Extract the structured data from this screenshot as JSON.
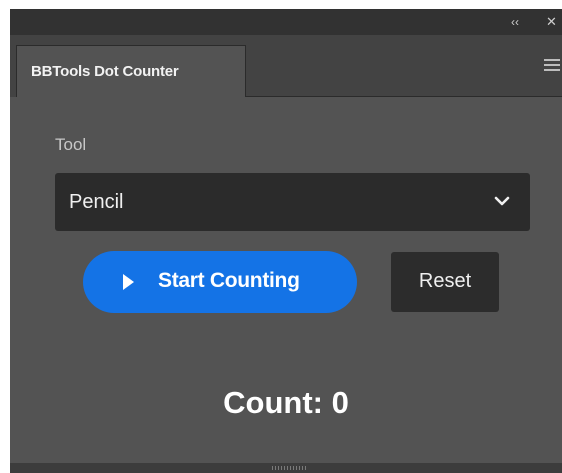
{
  "window": {
    "collapse_glyph": "‹‹",
    "close_glyph": "✕"
  },
  "tab": {
    "title": "BBTools Dot Counter"
  },
  "form": {
    "tool_label": "Tool",
    "tool_selected": "Pencil"
  },
  "buttons": {
    "start_label": "Start Counting",
    "reset_label": "Reset"
  },
  "count": {
    "text": "Count: 0"
  },
  "icons": {
    "collapse": "double-chevron-left-icon",
    "close": "close-icon",
    "menu": "hamburger-menu-icon",
    "dropdown": "chevron-down-icon",
    "play": "play-icon"
  },
  "colors": {
    "accent": "#1473e6",
    "panel_bg": "#535353",
    "field_bg": "#2b2b2b"
  }
}
